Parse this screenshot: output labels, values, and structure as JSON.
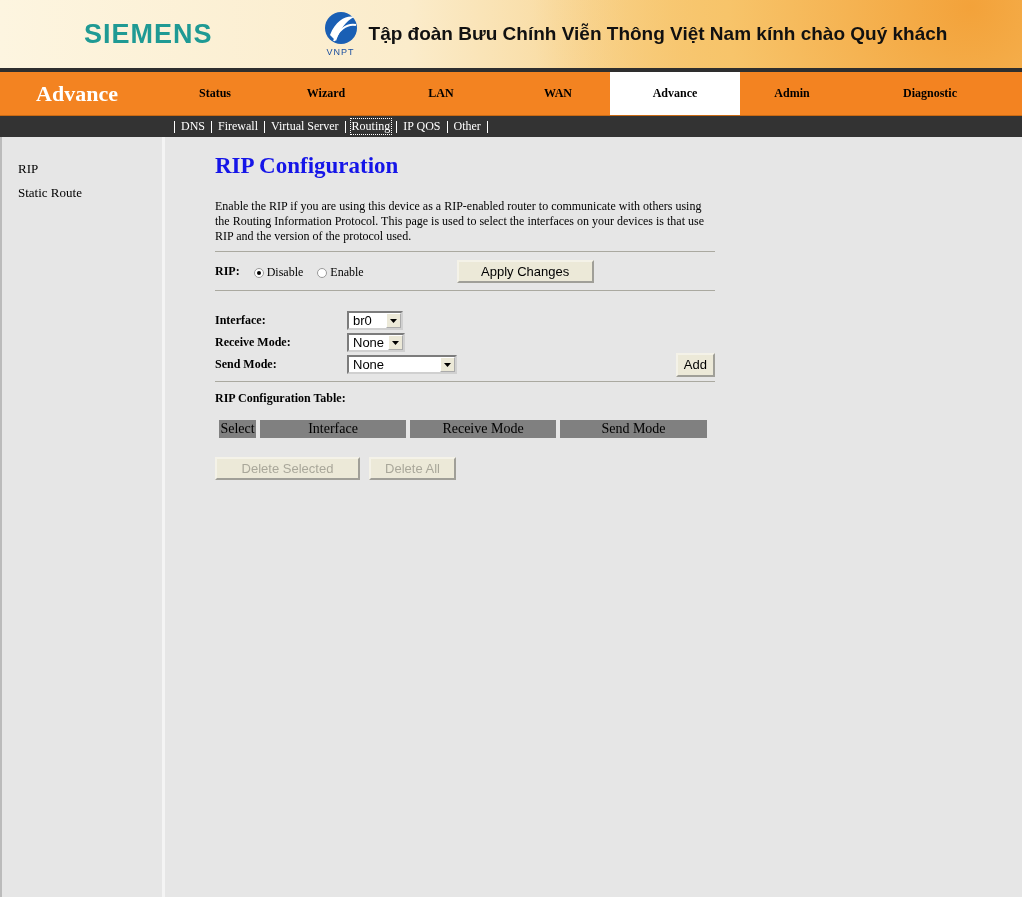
{
  "banner": {
    "brand": "SIEMENS",
    "logo_text": "VNPT",
    "greeting": "Tập đoàn Bưu Chính Viễn Thông Việt Nam kính chào Quý khách"
  },
  "nav": {
    "section_title": "Advance",
    "tabs": [
      {
        "label": "Status",
        "selected": false
      },
      {
        "label": "Wizard",
        "selected": false
      },
      {
        "label": "LAN",
        "selected": false
      },
      {
        "label": "WAN",
        "selected": false
      },
      {
        "label": "Advance",
        "selected": true
      },
      {
        "label": "Admin",
        "selected": false
      },
      {
        "label": "Diagnostic",
        "selected": false
      }
    ]
  },
  "subnav": [
    {
      "label": "DNS",
      "selected": false
    },
    {
      "label": "Firewall",
      "selected": false
    },
    {
      "label": "Virtual Server",
      "selected": false
    },
    {
      "label": "Routing",
      "selected": true
    },
    {
      "label": "IP QOS",
      "selected": false
    },
    {
      "label": "Other",
      "selected": false
    }
  ],
  "sidebar": {
    "items": [
      {
        "label": "RIP"
      },
      {
        "label": "Static Route"
      }
    ]
  },
  "content": {
    "title": "RIP Configuration",
    "description": "Enable the RIP if you are using this device as a RIP-enabled router to communicate with others using the Routing Information Protocol. This page is used to select the interfaces on your devices is that use RIP and the version of the protocol used.",
    "rip": {
      "label": "RIP:",
      "options": [
        {
          "label": "Disable",
          "selected": true
        },
        {
          "label": "Enable",
          "selected": false
        }
      ],
      "apply_button": "Apply Changes"
    },
    "fields": [
      {
        "label": "Interface:",
        "value": "br0"
      },
      {
        "label": "Receive Mode:",
        "value": "None"
      },
      {
        "label": "Send Mode:",
        "value": "None"
      }
    ],
    "add_button": "Add",
    "table": {
      "title": "RIP Configuration Table:",
      "columns": [
        "Select",
        "Interface",
        "Receive Mode",
        "Send Mode"
      ]
    },
    "buttons": [
      {
        "label": "Delete Selected",
        "disabled": true
      },
      {
        "label": "Delete All",
        "disabled": true
      }
    ]
  }
}
